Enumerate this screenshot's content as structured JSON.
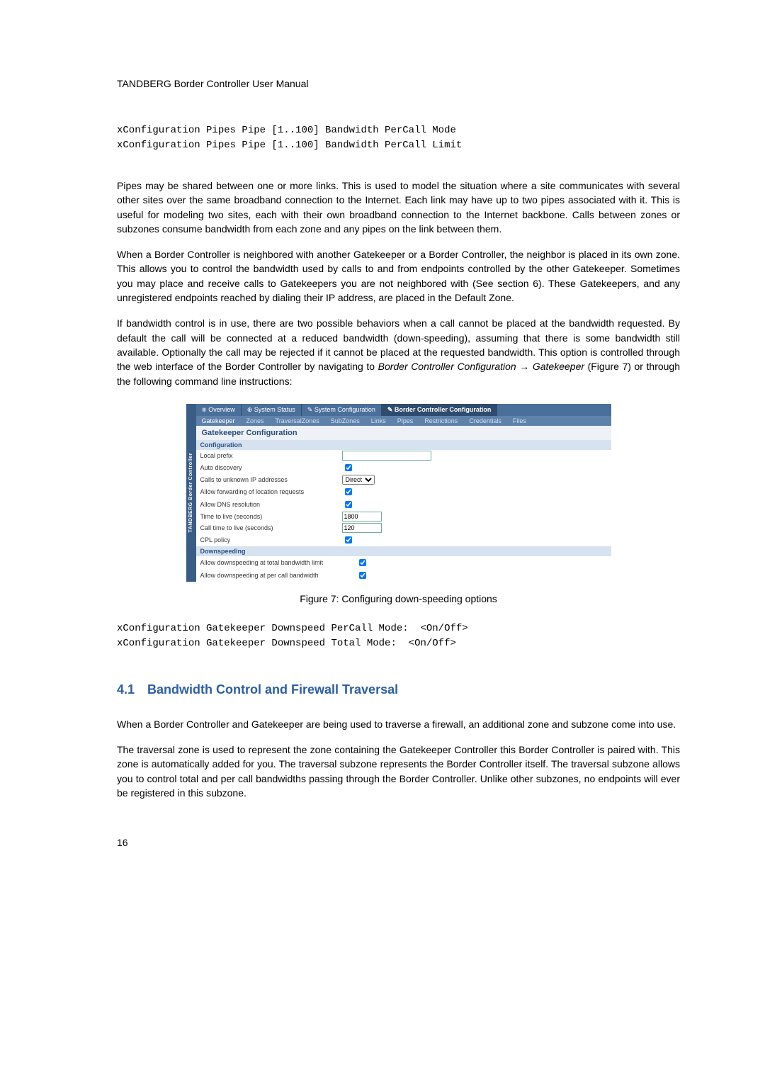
{
  "header": "TANDBERG Border Controller User Manual",
  "code1_line1": "xConfiguration Pipes Pipe [1..100] Bandwidth PerCall Mode",
  "code1_line2": "xConfiguration Pipes Pipe [1..100] Bandwidth PerCall Limit",
  "para1": "Pipes may be shared between one or more links. This is used to model the situation where a site communicates with several other sites over the same broadband connection to the Internet. Each link may have up to two pipes associated with it. This is useful for modeling two sites, each with their own broadband connection to the Internet backbone. Calls between zones or subzones consume bandwidth from each zone and any pipes on the link between them.",
  "para2": "When a Border Controller is neighbored with another Gatekeeper or a Border Controller, the neighbor is placed in its own zone. This allows you to control the bandwidth used by calls to and from endpoints controlled by the other Gatekeeper. Sometimes you may place and receive calls to Gatekeepers you are not neighbored with (See section 6). These Gatekeepers, and any unregistered endpoints reached by dialing their IP address, are placed in the Default Zone.",
  "para3_a": "If bandwidth control is in use, there are two possible behaviors when a call cannot be placed at the bandwidth requested. By default the call will be connected at a reduced bandwidth (down-speeding), assuming that there is some bandwidth still available. Optionally the call may be rejected if it cannot be placed at the requested bandwidth. This option is controlled through the web interface of the Border Controller by navigating to ",
  "para3_b": "Border Controller Configuration",
  "para3_c": " → ",
  "para3_d": "Gatekeeper",
  "para3_e": " (Figure 7) or through the following command line instructions:",
  "figure": {
    "side_label": "TANDBERG Border Controller",
    "tabs": {
      "overview": "⎈ Overview",
      "status": "⊕ System Status",
      "sysconf": "✎ System Configuration",
      "border": "✎ Border Controller Configuration"
    },
    "subtabs": {
      "gatekeeper": "Gatekeeper",
      "zones": "Zones",
      "travzones": "TraversalZones",
      "subzones": "SubZones",
      "links": "Links",
      "pipes": "Pipes",
      "restrictions": "Restrictions",
      "credentials": "Credentials",
      "files": "Files"
    },
    "title": "Gatekeeper Configuration",
    "section1": "Configuration",
    "rows": {
      "local_prefix": "Local prefix",
      "auto_discovery": "Auto discovery",
      "calls_unknown": "Calls to unknown IP addresses",
      "calls_unknown_val": "Direct",
      "allow_fwd": "Allow forwarding of location requests",
      "allow_dns": "Allow DNS resolution",
      "ttl": "Time to live (seconds)",
      "ttl_val": "1800",
      "call_ttl": "Call time to live (seconds)",
      "call_ttl_val": "120",
      "cpl": "CPL policy"
    },
    "section2": "Downspeeding",
    "rows2": {
      "ds_total": "Allow downspeeding at total bandwidth limit",
      "ds_percall": "Allow downspeeding at per call bandwidth"
    }
  },
  "figure_caption": "Figure 7: Configuring down-speeding options",
  "code2_line1": "xConfiguration Gatekeeper Downspeed PerCall Mode:  <On/Off>",
  "code2_line2": "xConfiguration Gatekeeper Downspeed Total Mode:  <On/Off>",
  "section_num": "4.1",
  "section_title": "Bandwidth Control and Firewall Traversal",
  "para4": "When a Border Controller and Gatekeeper are being used to traverse a firewall, an additional zone and subzone come into use.",
  "para5": "The traversal zone is used to represent the zone containing the Gatekeeper Controller this Border Controller is paired with. This zone is automatically added for you. The traversal subzone represents the Border Controller itself. The traversal subzone allows you to control total and per call bandwidths passing through the Border Controller. Unlike other subzones, no endpoints will ever be registered in this subzone.",
  "page_num": "16"
}
